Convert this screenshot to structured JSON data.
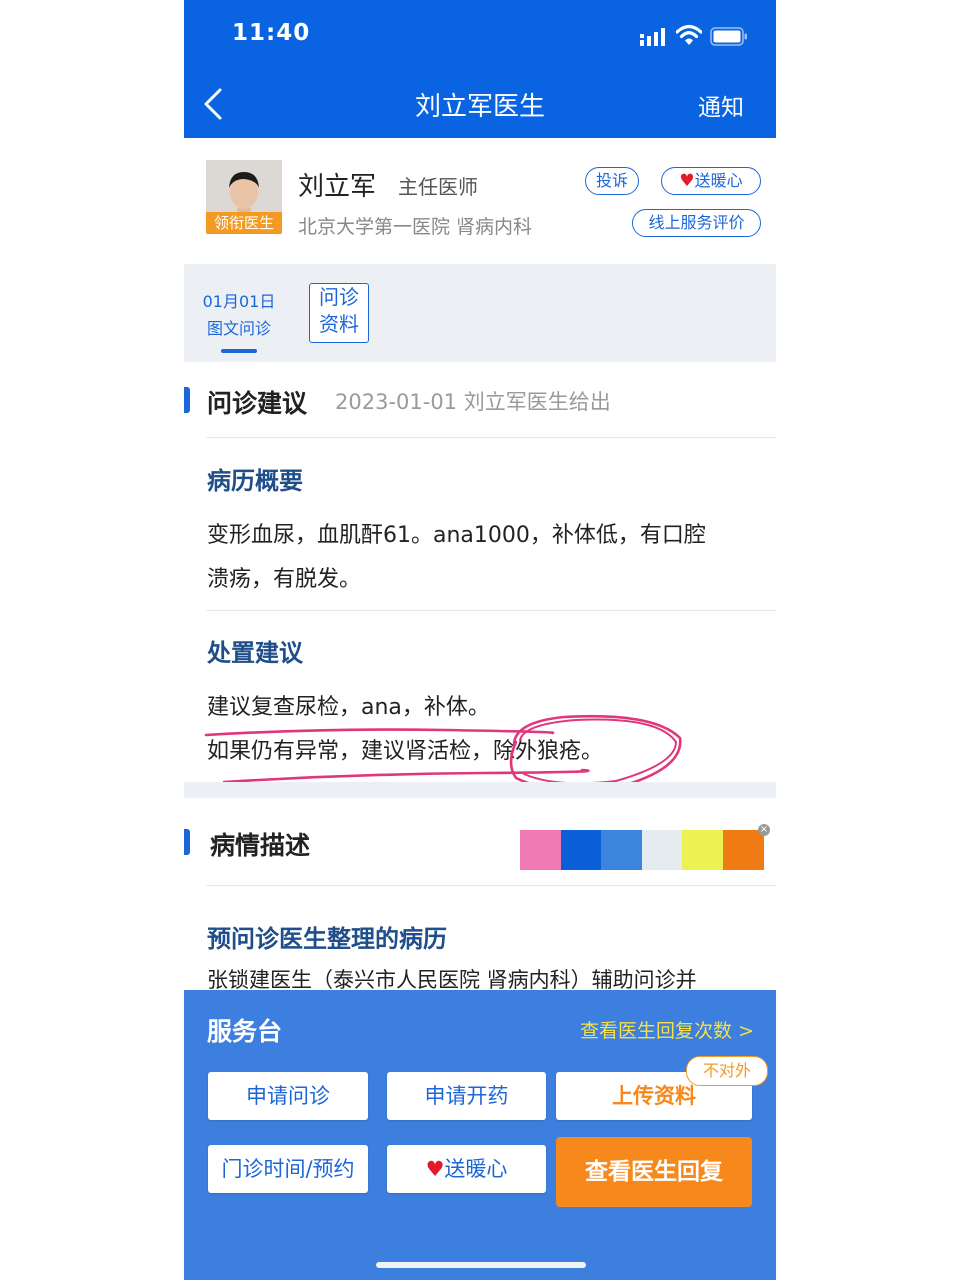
{
  "status_bar": {
    "time": "11:40"
  },
  "nav": {
    "title": "刘立军医生",
    "right_label": "通知"
  },
  "doctor": {
    "name": "刘立军",
    "title": "主任医师",
    "hospital": "北京大学第一医院 肾病内科",
    "avatar_tag": "领衔医生",
    "complain_label": "投诉",
    "gift_label": "送暖心",
    "rating_label": "线上服务评价"
  },
  "tabs": {
    "consult": {
      "date": "01月01日",
      "type": "图文问诊"
    },
    "records": {
      "line1": "问诊",
      "line2": "资料"
    }
  },
  "advice_section": {
    "title": "问诊建议",
    "meta": "2023-01-01 刘立军医生给出",
    "summary_heading": "病历概要",
    "summary_line1": "变形血尿，血肌酐61。ana1000，补体低，有口腔",
    "summary_line2": "溃疡，有脱发。",
    "treatment_heading": "处置建议",
    "treatment_line1": "建议复查尿检，ana，补体。",
    "treatment_line2": "如果仍有异常，建议肾活检，除外狼疮。"
  },
  "description_section": {
    "title": "病情描述",
    "swatch_colors": [
      "#f07ab3",
      "#0a5fd9",
      "#3b86dc",
      "#e6ebf0",
      "#eef152",
      "#f07b14"
    ],
    "pre_record_heading": "预问诊医生整理的病历",
    "pre_record_text": "张锁建医生（泰兴市人民医院 肾病内科）辅助问诊并"
  },
  "service_panel": {
    "title": "服务台",
    "link": "查看医生回复次数 >",
    "btn_apply_consult": "申请问诊",
    "btn_apply_prescription": "申请开药",
    "btn_upload": "上传资料",
    "badge_not_public": "不对外",
    "btn_clinic": "门诊时间/预约",
    "btn_gift": "送暖心",
    "btn_view_reply": "查看医生回复"
  },
  "colors": {
    "primary_blue": "#0a63e0",
    "panel_blue": "#3d7fde",
    "accent_orange": "#f7891c",
    "highlight_pink": "#e0367c"
  }
}
